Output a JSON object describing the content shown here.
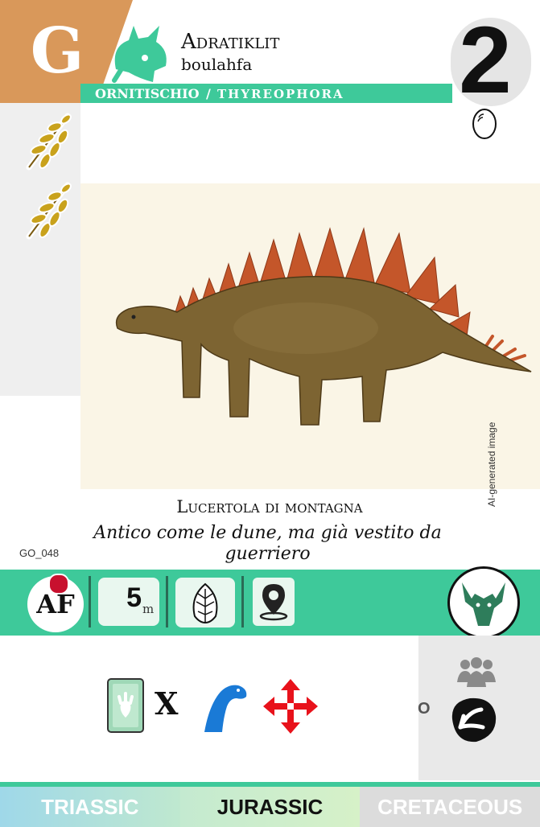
{
  "card": {
    "group_letter": "G",
    "title_line1": "Adratiklit",
    "title_line2": "boulahfa",
    "taxonomy_order": "ORNITISCHIO",
    "taxonomy_separator": "/",
    "taxonomy_suborder": "THYREOPHORA",
    "cost": "2",
    "common_name": "Lucertola di montagna",
    "flavor_text": "Antico come le dune, ma già vestito da guerriero",
    "card_id": "GO_048",
    "ai_credit": "AI-generated image",
    "icons": {
      "header": "triceratops-head-icon",
      "side": [
        "fern-leaf-icon",
        "fern-leaf-icon"
      ],
      "egg": "egg-icon"
    }
  },
  "stats": {
    "region": "AF",
    "size_value": "5",
    "size_unit": "m",
    "diet_icon": "leaf-icon",
    "habitat_icon": "location-pin-icon",
    "clade_icon": "ceratopsian-head-icon"
  },
  "action": {
    "cost_icon": "footprint-card-icon",
    "multiplier": "X",
    "target_icon": "sauropod-icon",
    "effect_icon": "move-arrows-icon",
    "alt_label": "O",
    "group_icon": "herd-icon",
    "alt_icon": "claw-icon"
  },
  "eras": [
    "TRIASSIC",
    "JURASSIC",
    "CRETACEOUS"
  ],
  "colors": {
    "accent": "#3ec99a",
    "corner": "#d9985a",
    "leaf": "#c9a21c",
    "region_dot": "#c8102e",
    "move_red": "#e8121b",
    "sauropod_blue": "#1a7ad6"
  }
}
